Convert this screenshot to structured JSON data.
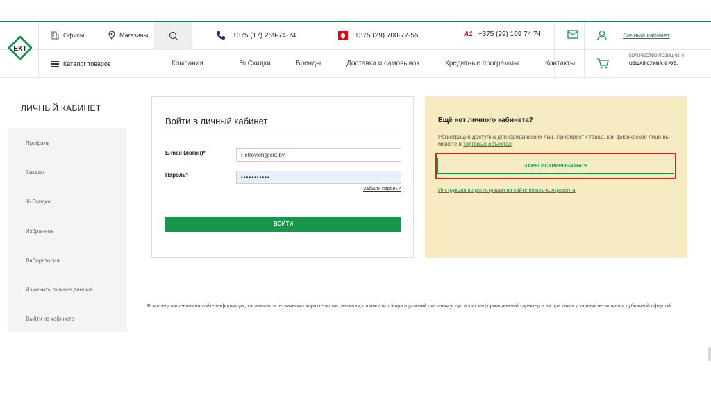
{
  "header": {
    "logo_text": "ЕКТ",
    "offices": "Офисы",
    "stores": "Магазины",
    "phones": [
      {
        "label": "+375 (17) 269-74-74",
        "icon": "phone-icon"
      },
      {
        "label": "+375 (29) 700-77-55",
        "icon": "mts-icon"
      },
      {
        "label": "+375 (29) 169 74 74",
        "icon": "a1-icon"
      }
    ],
    "account_link": "Личный кабинет",
    "catalog": "Каталог товаров",
    "nav": [
      "Компания",
      "% Скидки",
      "Бренды",
      "Доставка и самовывоз",
      "Кредитные программы",
      "Контакты"
    ],
    "cart": {
      "count_label": "КОЛИЧЕСТВО ПОЗИЦИЙ: 0",
      "total_label": "ОБЩАЯ СУММА: 0 РУБ."
    },
    "a1_mark": "A1"
  },
  "sidebar": {
    "title": "ЛИЧНЫЙ КАБИНЕТ",
    "items": [
      "Профиль",
      "Заказы",
      "% Скидки",
      "Избранное",
      "Лаборатория",
      "Изменить личные данные",
      "Выйти из кабинета"
    ]
  },
  "login": {
    "title": "Войти в личный кабинет",
    "email_label": "E-mail (логин)",
    "password_label": "Пароль",
    "required_mark": "*",
    "email_value": "Petrovich@ekt.by",
    "password_value": "•••••••••••",
    "forgot": "Забыли пароль?",
    "submit": "ВОЙТИ"
  },
  "register": {
    "title": "Ещё нет личного кабинета?",
    "desc_text": "Регистрация доступна для юридических лиц. Приобрести товар, как физическое лицо вы можете в ",
    "desc_link": "торговых объектах",
    "desc_end": ".",
    "button": "ЗАРЕГИСТРИРОВАТЬСЯ",
    "instruction": "Инструкция по регистрации на сайте нового контрагента"
  },
  "disclaimer": "Вся представленная на сайте информация, касающаяся технических характеристик, наличия, стоимости товара и условий оказания услуг, носит информационный характер и ни при каких условиях не является публичной офертой.",
  "colors": {
    "brand_green": "#17954a",
    "register_bg": "#f6ebc1",
    "highlight_red": "#e02020"
  }
}
